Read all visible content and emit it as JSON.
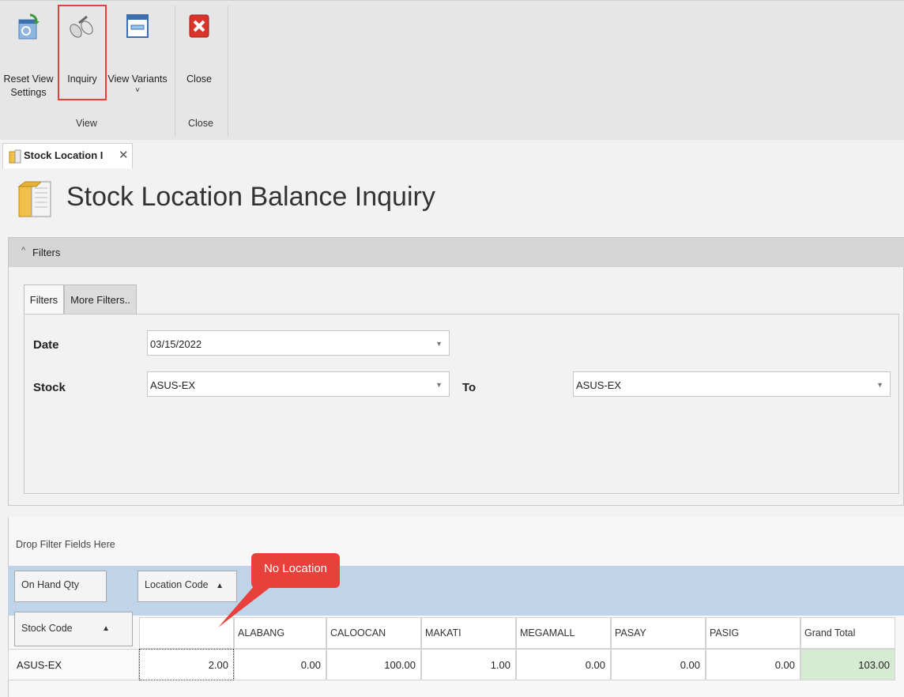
{
  "ribbon": {
    "buttons": [
      {
        "label1": "Reset View",
        "label2": "Settings"
      },
      {
        "label1": "Inquiry",
        "label2": ""
      },
      {
        "label1": "View Variants",
        "label2": "˅"
      },
      {
        "label1": "Close",
        "label2": ""
      }
    ],
    "groups": [
      "View",
      "Close"
    ]
  },
  "tab": {
    "label": "Stock Location I",
    "close": "✕"
  },
  "page": {
    "title": "Stock Location Balance Inquiry"
  },
  "filters": {
    "header": "Filters",
    "tabs": [
      "Filters",
      "More Filters.."
    ],
    "date_label": "Date",
    "date_value": "03/15/2022",
    "stock_label": "Stock",
    "stock_from": "ASUS-EX",
    "to_label": "To",
    "stock_to": "ASUS-EX"
  },
  "pivot": {
    "drop_filter": "Drop Filter Fields Here",
    "data_field": "On Hand Qty",
    "column_field": "Location Code",
    "row_field": "Stock Code",
    "columns": [
      "",
      "ALABANG",
      "CALOOCAN",
      "MAKATI",
      "MEGAMALL",
      "PASAY",
      "PASIG",
      "Grand Total"
    ],
    "rows": [
      {
        "code": "ASUS-EX",
        "values": [
          "2.00",
          "0.00",
          "100.00",
          "1.00",
          "0.00",
          "0.00",
          "0.00",
          "103.00"
        ]
      }
    ]
  },
  "callout": {
    "text": "No Location"
  },
  "colors": {
    "highlight": "#e8413c",
    "grand_total_bg": "#d6ecd2",
    "pivot_bar": "#bfd3e9"
  }
}
